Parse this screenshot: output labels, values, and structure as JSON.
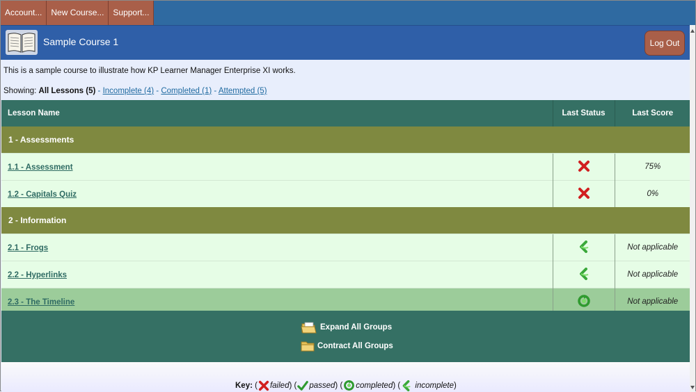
{
  "menu": {
    "items": [
      {
        "label": "Account..."
      },
      {
        "label": "New Course..."
      },
      {
        "label": "Support..."
      }
    ]
  },
  "course": {
    "title": "Sample Course 1",
    "logout_label": "Log Out"
  },
  "description": "This is a sample course to illustrate how KP Learner Manager Enterprise XI works.",
  "showing": {
    "prefix": "Showing:",
    "all": "All Lessons (5)",
    "sep": "-",
    "incomplete": "Incomplete (4)",
    "completed": "Completed (1)",
    "attempted": "Attempted (5)"
  },
  "table": {
    "headers": {
      "name": "Lesson Name",
      "status": "Last Status",
      "score": "Last Score"
    },
    "groups": [
      {
        "title": "1 - Assessments",
        "lessons": [
          {
            "name": "1.1 - Assessment",
            "status": "failed",
            "score": "75%"
          },
          {
            "name": "1.2 - Capitals Quiz",
            "status": "failed",
            "score": "0%"
          }
        ]
      },
      {
        "title": "2 - Information",
        "lessons": [
          {
            "name": "2.1 - Frogs",
            "status": "incomplete",
            "score": "Not applicable"
          },
          {
            "name": "2.2 - Hyperlinks",
            "status": "incomplete",
            "score": "Not applicable"
          },
          {
            "name": "2.3 - The Timeline",
            "status": "completed",
            "score": "Not applicable"
          }
        ]
      }
    ]
  },
  "actions": {
    "expand": "Expand All Groups",
    "contract": "Contract All Groups"
  },
  "key": {
    "label": "Key:",
    "failed": "failed",
    "passed": "passed",
    "completed": "completed",
    "incomplete": "incomplete"
  },
  "colors": {
    "menu_button": "#a95f49",
    "header_blue": "#2f5fa8",
    "table_header": "#357064",
    "group_row": "#7f8940",
    "row_bg": "#e6fde6",
    "selected_row": "#9ccc9a"
  },
  "icons": {
    "book": "book-icon",
    "failed": "red-x-icon",
    "passed": "green-check-icon",
    "completed": "completed-cycle-icon",
    "incomplete": "incomplete-arrow-icon",
    "expand": "open-folder-icon",
    "contract": "closed-folder-icon"
  }
}
